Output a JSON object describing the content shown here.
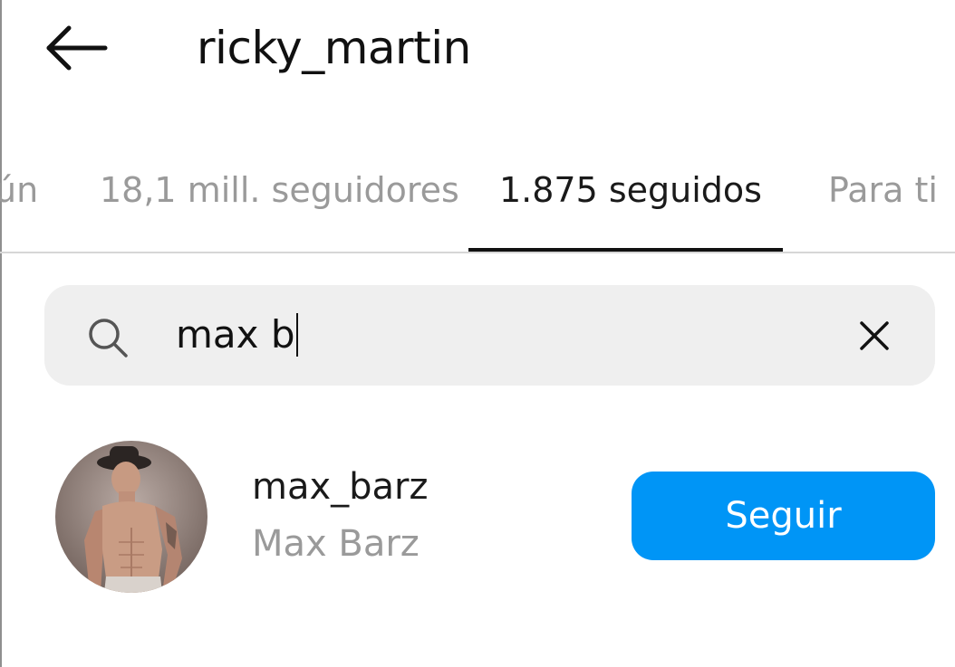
{
  "header": {
    "title": "ricky_martin",
    "back_icon": "arrow-left-icon"
  },
  "tabs": [
    {
      "label": "ún",
      "active": false
    },
    {
      "label": "18,1 mill. seguidores",
      "active": false
    },
    {
      "label": "1.875 seguidos",
      "active": true
    },
    {
      "label": "Para ti",
      "active": false
    }
  ],
  "search": {
    "icon": "search-icon",
    "value": "max b",
    "clear_icon": "close-icon"
  },
  "results": [
    {
      "username": "max_barz",
      "full_name": "Max Barz",
      "avatar": "profile-photo",
      "button_label": "Seguir"
    }
  ],
  "colors": {
    "accent": "#0095f6",
    "text": "#111111",
    "muted": "#9a9a9a",
    "search_bg": "#efefef",
    "divider": "#d6d6d6"
  }
}
